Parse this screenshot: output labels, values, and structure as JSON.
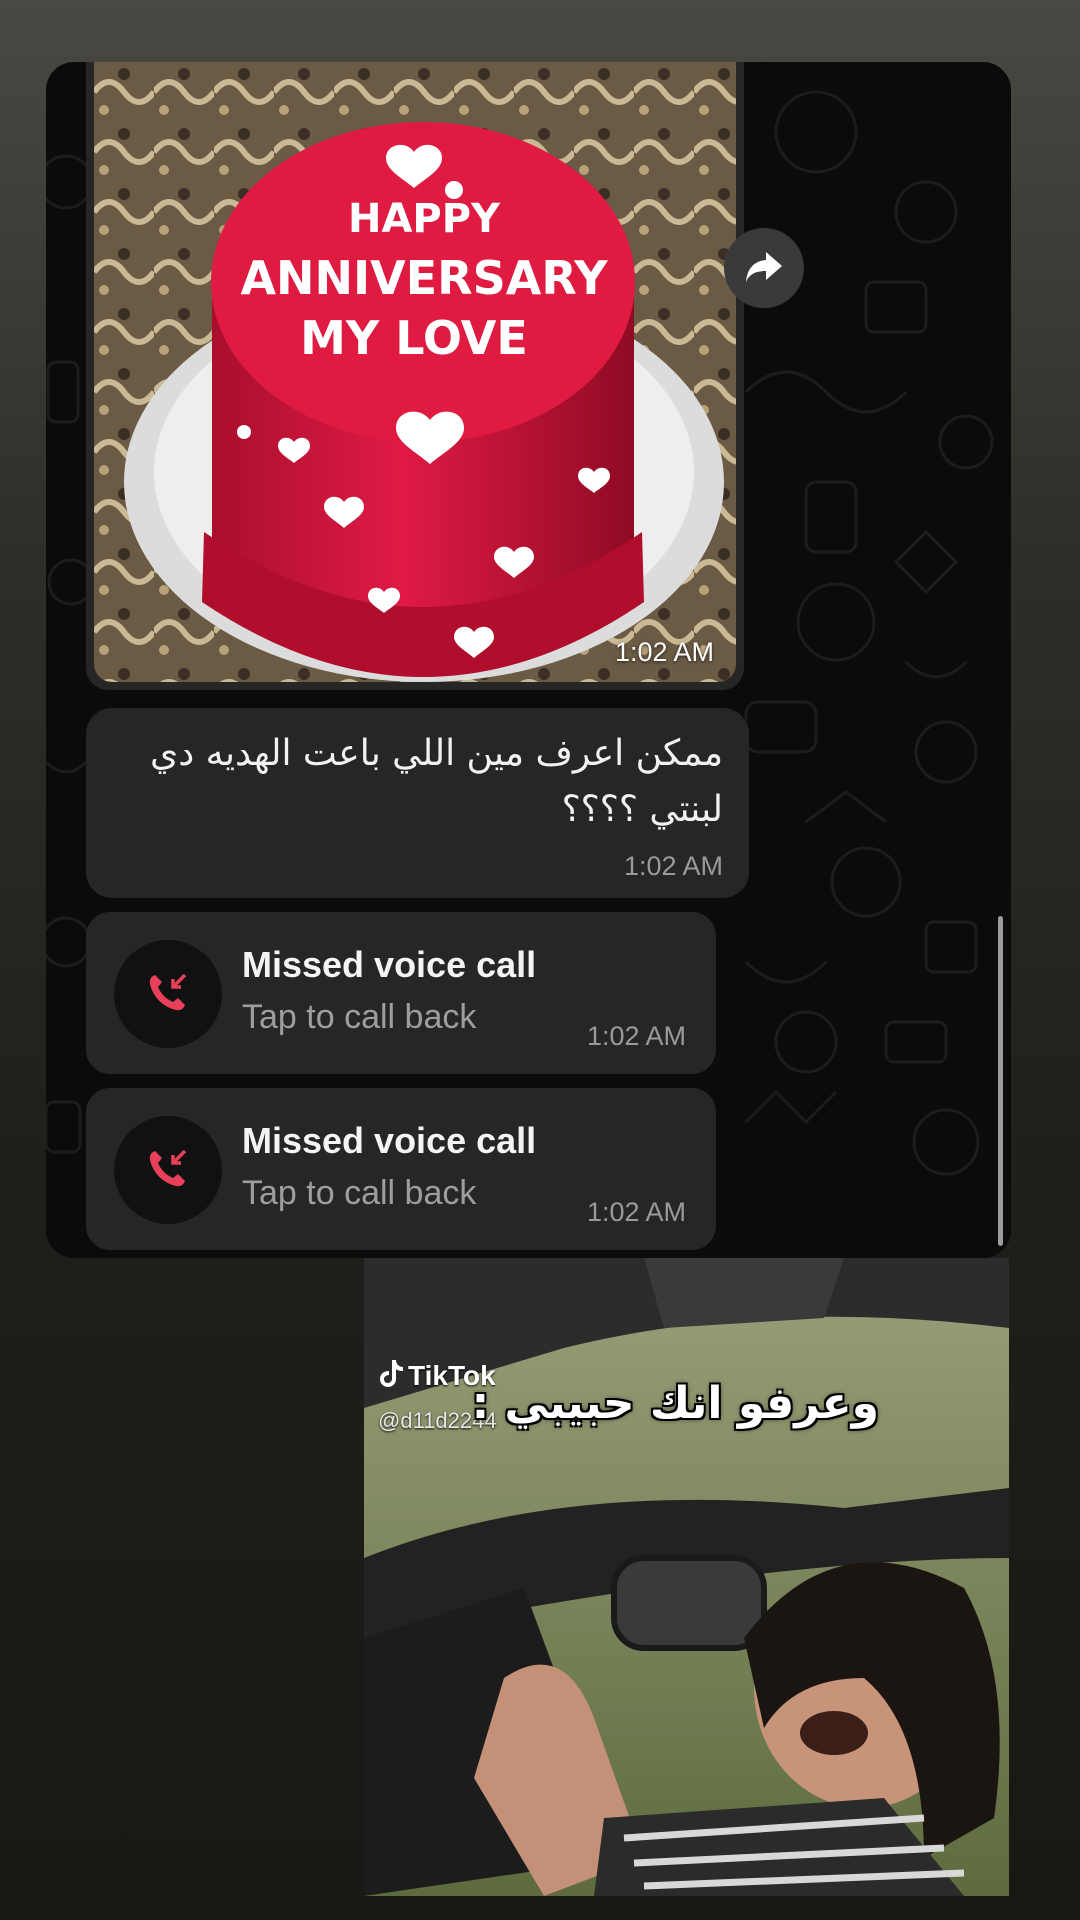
{
  "image_message": {
    "cake_text_line1": "HAPPY",
    "cake_text_line2": "ANNIVERSARY",
    "cake_text_line3": "MY LOVE",
    "time": "1:02 AM"
  },
  "text_message": {
    "body": "ممكن اعرف مين اللي باعت الهديه دي لبنتي ؟؟؟؟",
    "time": "1:02 AM"
  },
  "missed_calls": [
    {
      "title": "Missed voice call",
      "subtitle": "Tap to call back",
      "time": "1:02 AM"
    },
    {
      "title": "Missed voice call",
      "subtitle": "Tap to call back",
      "time": "1:02 AM"
    }
  ],
  "meme": {
    "tiktok_label": "TikTok",
    "tiktok_handle": "@d11d2244",
    "caption": "وعرفو انك حبيبي :"
  },
  "colors": {
    "missed_call_icon": "#e8405a",
    "cake_red": "#d8123a",
    "bubble_bg": "#262626"
  },
  "icons": [
    "forward-icon",
    "missed-call-icon",
    "tiktok-logo-icon"
  ]
}
